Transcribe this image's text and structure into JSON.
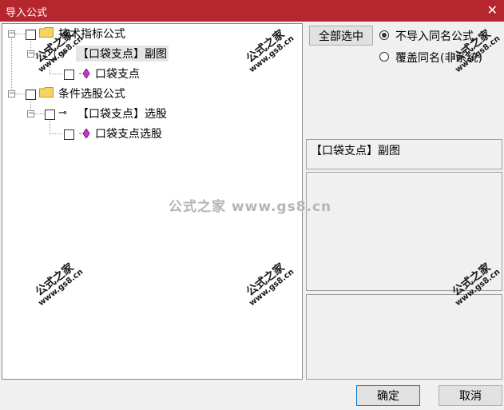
{
  "window": {
    "title": "导入公式",
    "close_glyph": "✕"
  },
  "tree": {
    "items": [
      {
        "label": "技术指标公式",
        "type": "folder"
      },
      {
        "label": "【口袋支点】副图",
        "type": "key"
      },
      {
        "label": "口袋支点",
        "type": "formula"
      },
      {
        "label": "条件选股公式",
        "type": "folder"
      },
      {
        "label": "【口袋支点】选股",
        "type": "key"
      },
      {
        "label": "口袋支点选股",
        "type": "formula"
      }
    ]
  },
  "actions": {
    "select_all": "全部选中"
  },
  "options": {
    "no_import_same": "不导入同名公式",
    "overwrite_same": "覆盖同名(非系统)",
    "selected": "no_import_same"
  },
  "detail": {
    "selected_name": "【口袋支点】副图"
  },
  "buttons": {
    "ok": "确定",
    "cancel": "取消"
  },
  "watermark": {
    "center": "公式之家 www.gs8.cn",
    "stamp_cn": "公式之家",
    "stamp_url": "www.gs8.cn"
  },
  "colors": {
    "titlebar": "#b5262e",
    "gem": "#cc33cc",
    "folder": "#f5d561"
  }
}
